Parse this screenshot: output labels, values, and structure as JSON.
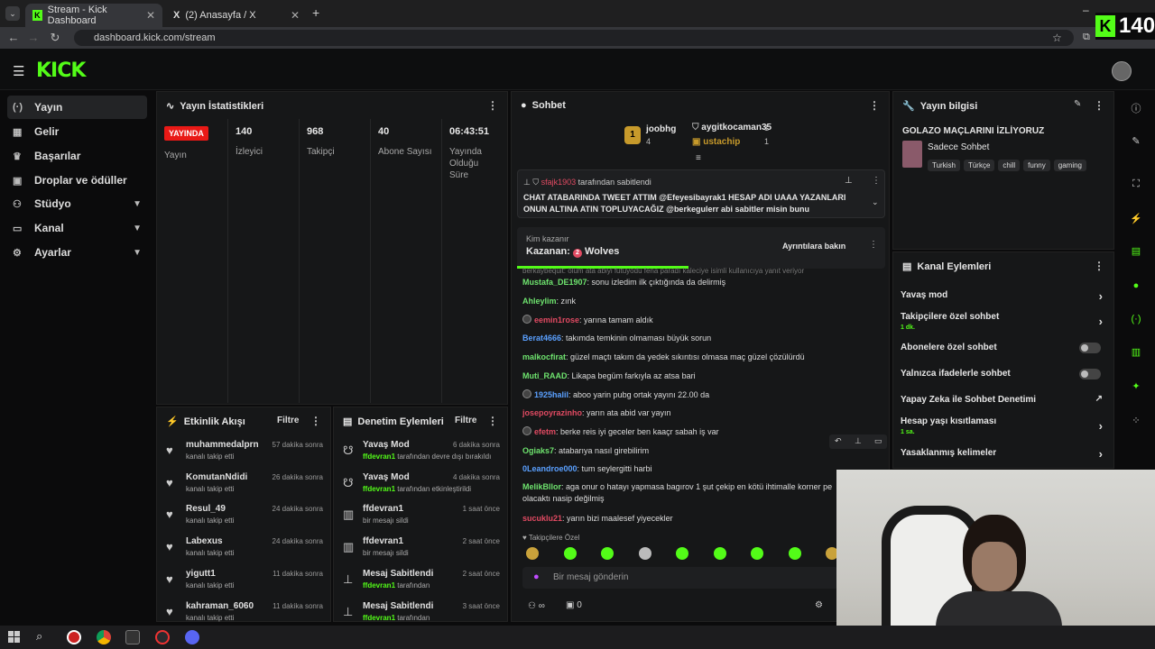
{
  "browser": {
    "tabs": [
      {
        "title": "Stream - Kick Dashboard"
      },
      {
        "title": "(2) Anasayfa / X"
      }
    ],
    "url": "dashboard.kick.com/stream"
  },
  "overlay": {
    "viewer_count": "140"
  },
  "sidebar": {
    "items": [
      {
        "label": "Yayın",
        "icon": "broadcast-icon"
      },
      {
        "label": "Gelir",
        "icon": "money-icon"
      },
      {
        "label": "Başarılar",
        "icon": "trophy-icon"
      },
      {
        "label": "Droplar ve ödüller",
        "icon": "gift-icon"
      },
      {
        "label": "Stüdyo",
        "icon": "studio-icon"
      },
      {
        "label": "Kanal",
        "icon": "channel-icon"
      },
      {
        "label": "Ayarlar",
        "icon": "gear-icon"
      }
    ]
  },
  "stats": {
    "title": "Yayın İstatistikleri",
    "live_badge": "YAYINDA",
    "live_label": "Yayın",
    "viewers_value": "140",
    "viewers_label": "İzleyici",
    "followers_value": "968",
    "followers_label": "Takipçi",
    "subs_value": "40",
    "subs_label": "Abone Sayısı",
    "uptime_value": "06:43:51",
    "uptime_label": "Yayında Olduğu Süre"
  },
  "activity": {
    "title": "Etkinlik Akışı",
    "filter": "Filtre",
    "items": [
      {
        "name": "muhammedalprn",
        "sub": "kanalı takip etti",
        "time": "57 dakika sonra"
      },
      {
        "name": "KomutanNdidi",
        "sub": "kanalı takip etti",
        "time": "26 dakika sonra"
      },
      {
        "name": "Resul_49",
        "sub": "kanalı takip etti",
        "time": "24 dakika sonra"
      },
      {
        "name": "Labexus",
        "sub": "kanalı takip etti",
        "time": "24 dakika sonra"
      },
      {
        "name": "yigutt1",
        "sub": "kanalı takip etti",
        "time": "11 dakika sonra"
      },
      {
        "name": "kahraman_6060",
        "sub": "kanalı takip etti",
        "time": "11 dakika sonra"
      }
    ]
  },
  "moderation": {
    "title": "Denetim Eylemleri",
    "filter": "Filtre",
    "items": [
      {
        "name": "Yavaş Mod",
        "sub_user": "ffdevran1",
        "sub": "tarafından devre dışı bırakıldı",
        "time": "6 dakika sonra"
      },
      {
        "name": "Yavaş Mod",
        "sub_user": "ffdevran1",
        "sub": "tarafından etkinleştirildi",
        "time": "4 dakika sonra"
      },
      {
        "name": "ffdevran1",
        "sub_user": "",
        "sub": "bir mesajı sildi",
        "time": "1 saat önce"
      },
      {
        "name": "ffdevran1",
        "sub_user": "",
        "sub": "bir mesajı sildi",
        "time": "2 saat önce"
      },
      {
        "name": "Mesaj Sabitlendi",
        "sub_user": "ffdevran1",
        "sub": "tarafından",
        "time": "2 saat önce"
      },
      {
        "name": "Mesaj Sabitlendi",
        "sub_user": "ffdevran1",
        "sub": "tarafından",
        "time": "3 saat önce"
      }
    ]
  },
  "chat": {
    "title": "Sohbet",
    "leader": {
      "rank": "1",
      "name": "joobhg",
      "count": "4"
    },
    "top": [
      {
        "name": "aygitkocaman35",
        "count": "1"
      },
      {
        "name": "ustachip",
        "count": "1"
      }
    ],
    "pinned": {
      "user": "sfajk1903",
      "by": "tarafından sabitlendi",
      "text": "CHAT ATABARINDA TWEET ATTIM @Efeyesibayrak1 HESAP ADI UAAA YAZANLARI ONUN ALTINA ATIN TOPLUYACAĞIZ @berkegulerr abi sabitler misin bunu"
    },
    "poll": {
      "question": "Kim kazanır",
      "result_label": "Kazanan:",
      "winner": "Wolves",
      "details": "Ayrıntılara bakın"
    },
    "faded": "berkaybequit: ölüm ata abiyi futuyodu fena paradı kaleciye isimli kullanıcıya yanıt veriyor",
    "messages": [
      {
        "user": "Mustafa_DE1907",
        "text": ": sonu izledim ilk çıktığında da delirmiş",
        "color": "#6ee36e",
        "badge": false
      },
      {
        "user": "Ahleylim",
        "text": ": zınk",
        "color": "#6ee36e",
        "badge": false
      },
      {
        "user": "eemin1rose",
        "text": ": yarına tamam aldık",
        "color": "#e14a62",
        "badge": true
      },
      {
        "user": "Berat4666",
        "text": ": takımda temkinin olmaması büyük sorun",
        "color": "#5aa0ff",
        "badge": false
      },
      {
        "user": "malkocfirat",
        "text": ": güzel maçtı takım da yedek sıkıntısı olmasa maç güzel çözülürdü",
        "color": "#6ee36e",
        "badge": false
      },
      {
        "user": "Muti_RAAD",
        "text": ": Likapa begüm farkıyla az atsa bari",
        "color": "#6ee36e",
        "badge": false
      },
      {
        "user": "1925halil",
        "text": ": aboo yarin pubg ortak yayını 22.00 da",
        "color": "#5aa0ff",
        "badge": true
      },
      {
        "user": "josepoyrazinho",
        "text": ": yarın ata abid var yayın",
        "color": "#e14a62",
        "badge": false
      },
      {
        "user": "efetm",
        "text": ": berke reis iyi geceler ben kaaçr sabah iş var",
        "color": "#e14a62",
        "badge": true
      },
      {
        "user": "Ogiaks7",
        "text": ": atabarıya nasıl girebilirim",
        "color": "#6ee36e",
        "badge": false
      },
      {
        "user": "0Leandroe000",
        "text": ": tum seylergitti harbi",
        "color": "#5aa0ff",
        "badge": false
      },
      {
        "user": "MelikBllor",
        "text": ": aga onur o hatayı yapmasa bagırov 1 şut çekip en kötü ihtimalle korner pe olacaktı nasip değilmiş",
        "color": "#6ee36e",
        "badge": false
      },
      {
        "user": "sucuklu21",
        "text": ": yarın bizi maalesef yiyecekler",
        "color": "#e14a62",
        "badge": false
      }
    ],
    "followers_only": "Takipçilere Özel",
    "input_placeholder": "Bir mesaj gönderin",
    "points": "0"
  },
  "stream_info": {
    "title": "Yayın bilgisi",
    "stream_title": "GOLAZO MAÇLARINI İZLİYORUZ",
    "category": "Sadece Sohbet",
    "tags": [
      "Turkish",
      "Türkçe",
      "chill",
      "funny",
      "gaming"
    ]
  },
  "channel_actions": {
    "title": "Kanal Eylemleri",
    "items": [
      {
        "label": "Yavaş mod",
        "sub": "",
        "type": "chevron"
      },
      {
        "label": "Takipçilere özel sohbet",
        "sub": "1 dk.",
        "type": "chevron"
      },
      {
        "label": "Abonelere özel sohbet",
        "sub": "",
        "type": "toggle"
      },
      {
        "label": "Yalnızca ifadelerle sohbet",
        "sub": "",
        "type": "toggle"
      },
      {
        "label": "Yapay Zeka ile Sohbet Denetimi",
        "sub": "",
        "type": "external"
      },
      {
        "label": "Hesap yaşı kısıtlaması",
        "sub": "1 sa.",
        "type": "chevron"
      },
      {
        "label": "Yasaklanmış kelimeler",
        "sub": "",
        "type": "chevron"
      }
    ]
  },
  "colors": {
    "brand": "#53fc18",
    "live": "#e91916"
  }
}
